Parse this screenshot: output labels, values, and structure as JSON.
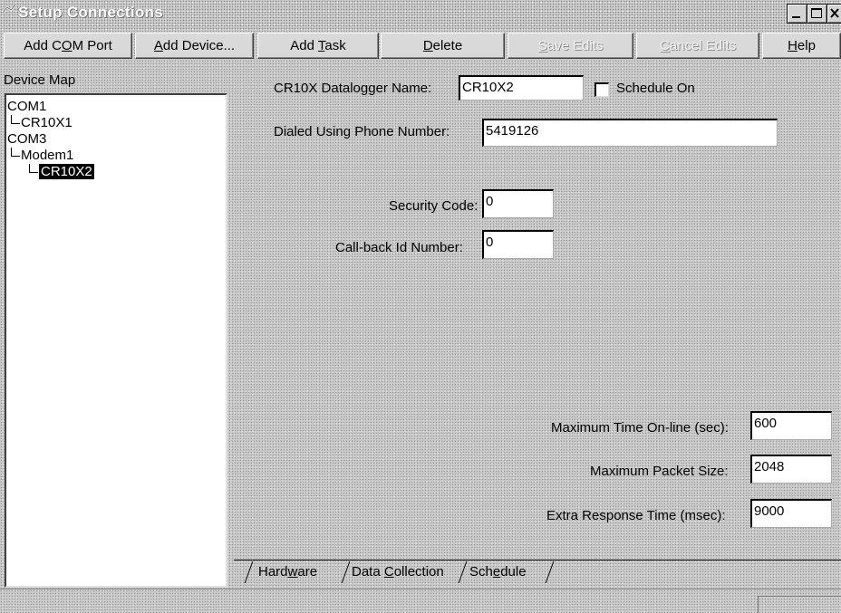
{
  "window": {
    "title": "Setup Connections",
    "controls": [
      "minimize",
      "maximize",
      "close"
    ]
  },
  "toolbar": {
    "add_com_port": {
      "pre": "Add C",
      "key": "O",
      "post": "M Port"
    },
    "add_device": {
      "pre": "",
      "key": "A",
      "post": "dd Device..."
    },
    "add_task": {
      "pre": "Add ",
      "key": "T",
      "post": "ask"
    },
    "delete": {
      "pre": "",
      "key": "D",
      "post": "elete"
    },
    "save_edits": {
      "pre": "",
      "key": "S",
      "post": "ave Edits"
    },
    "cancel_edits": {
      "pre": "",
      "key": "C",
      "post": "ancel Edits"
    },
    "help": {
      "pre": "",
      "key": "H",
      "post": "elp"
    }
  },
  "device_map": {
    "label": "Device Map",
    "items": [
      {
        "label": "COM1",
        "level": 0
      },
      {
        "label": "CR10X1",
        "level": 1
      },
      {
        "label": "COM3",
        "level": 0
      },
      {
        "label": "Modem1",
        "level": 1
      },
      {
        "label": "CR10X2",
        "level": 2,
        "selected": true
      }
    ]
  },
  "form": {
    "datalogger_name_label": "CR10X Datalogger Name:",
    "datalogger_name_value": "CR10X2",
    "schedule_on_label": "Schedule On",
    "schedule_on_checked": false,
    "phone_label": "Dialed Using Phone Number:",
    "phone_value": "5419126",
    "security_code_label": "Security Code:",
    "security_code_value": "0",
    "callback_label": "Call-back Id Number:",
    "callback_value": "0",
    "max_time_label": "Maximum Time On-line (sec):",
    "max_time_value": "600",
    "max_packet_label": "Maximum Packet Size:",
    "max_packet_value": "2048",
    "extra_response_label": "Extra Response Time (msec):",
    "extra_response_value": "9000"
  },
  "tabs": {
    "hardware": {
      "pre": "Hard",
      "key": "w",
      "post": "are",
      "active": true
    },
    "data_collection": {
      "pre": "Data ",
      "key": "C",
      "post": "ollection"
    },
    "schedule": {
      "pre": "Sch",
      "key": "e",
      "post": "dule"
    }
  }
}
